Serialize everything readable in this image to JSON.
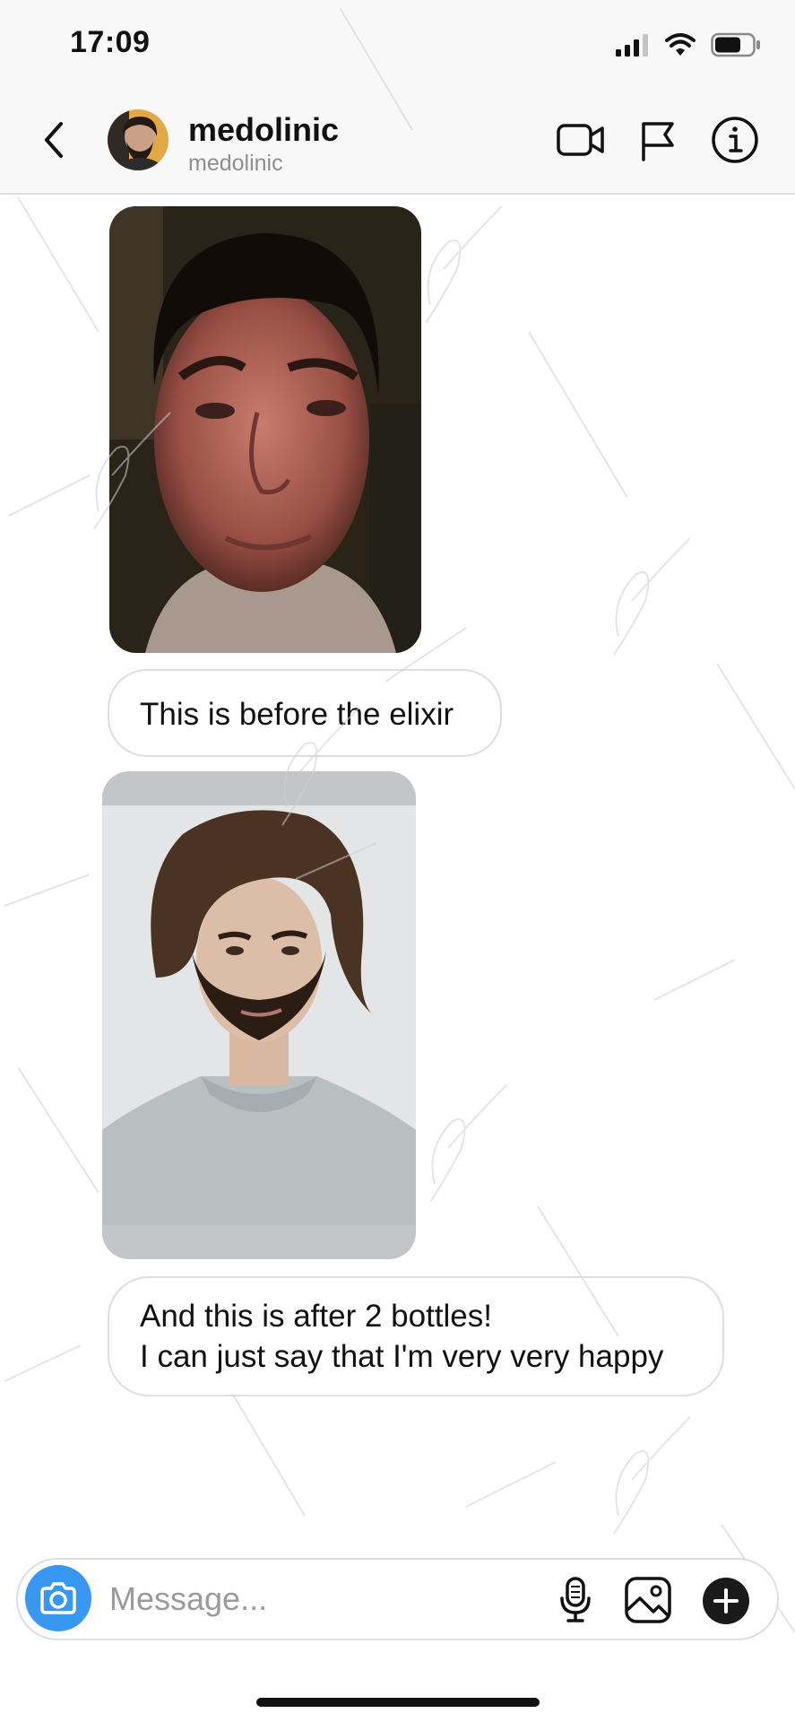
{
  "status_bar": {
    "time": "17:09"
  },
  "header": {
    "display_name": "medolinic",
    "username": "medolinic"
  },
  "icons": {
    "back": "chevron-left-icon",
    "video": "video-camera-icon",
    "report": "flag-icon",
    "info": "info-icon",
    "camera": "camera-icon",
    "mic": "microphone-icon",
    "gallery": "gallery-icon",
    "plus": "plus-icon"
  },
  "messages": [
    {
      "type": "photo",
      "description": "before photo"
    },
    {
      "type": "text",
      "text": "This is before the elixir"
    },
    {
      "type": "photo",
      "description": "after photo"
    },
    {
      "type": "text",
      "lines": [
        "And this is after 2 bottles!",
        "I can just say that I'm very very happy"
      ]
    }
  ],
  "composer": {
    "placeholder": "Message..."
  },
  "colors": {
    "accent": "#3897f0",
    "bubble_border": "#dedede",
    "header_bg": "#f8f8f8"
  }
}
